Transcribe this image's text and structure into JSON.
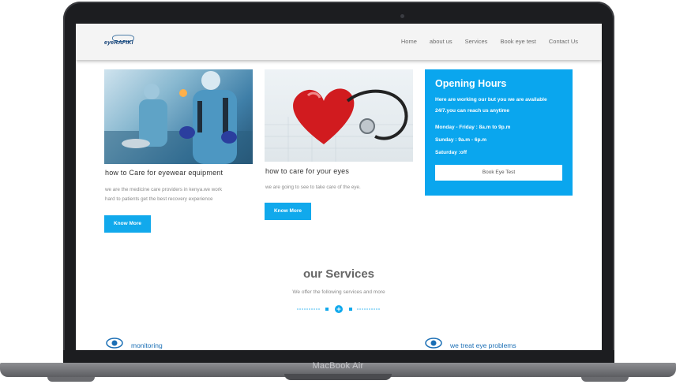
{
  "device": {
    "label": "MacBook Air"
  },
  "site": {
    "logo_text": "eyeRAFIKI",
    "nav": [
      "Home",
      "about us",
      "Services",
      "Book eye test",
      "Contact Us"
    ]
  },
  "cards": [
    {
      "title": "how to Care for eyewear equipment",
      "text_lines": [
        "we are the medicine care providers in kenya.we work",
        "hard to patients get the best recovery experience"
      ],
      "button": "Know More"
    },
    {
      "title": "how to care for your eyes",
      "text_lines": [
        "we are going to see to take care of the eye."
      ],
      "button": "Know More"
    }
  ],
  "hours": {
    "title": "Opening Hours",
    "intro_lines": [
      "Here are working our but you we are available",
      "24/7.you can reach us anytime"
    ],
    "schedule": [
      "Monday - Friday : 8a.m to 9p.m",
      "Sunday : 9a.m - 6p.m",
      "Saturday :off"
    ],
    "button": "Book Eye Test"
  },
  "services": {
    "title": "our Services",
    "subtitle": "We offer the following services and more",
    "items": [
      "monitoring",
      "we treat eye problems"
    ]
  },
  "colors": {
    "accent": "#0aa6ee",
    "button": "#11a9ec",
    "link": "#1b6fb5"
  }
}
